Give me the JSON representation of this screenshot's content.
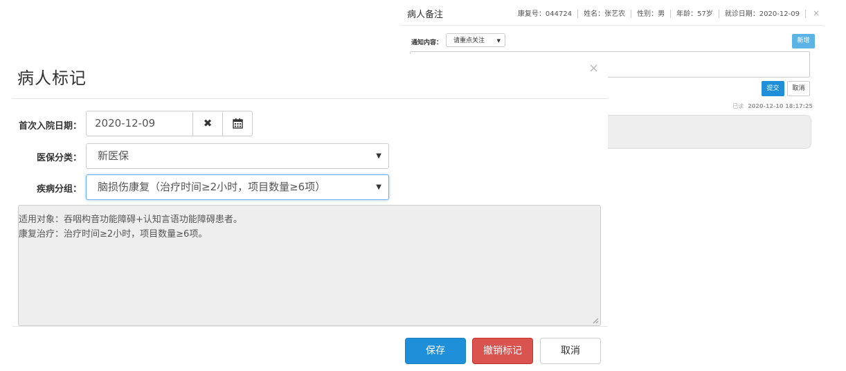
{
  "notes_panel": {
    "title": "病人备注",
    "info": {
      "rehab_no": "康复号：044724",
      "name": "姓名：张艺农",
      "gender": "性别：男",
      "age": "年龄：57岁",
      "visit_date": "就诊日期：2020-12-09",
      "close": "×"
    },
    "notify_label": "通知内容：",
    "notify_select": "请重点关注",
    "add_button": "新增",
    "submit_button": "提交",
    "cancel_button": "取消",
    "read_status": "已读",
    "read_time": "2020-12-10 18:17:25"
  },
  "modal": {
    "title": "病人标记",
    "close": "×",
    "first_admission_label": "首次入院日期：",
    "first_admission_value": "2020-12-09",
    "clear_glyph": "✖",
    "insurance_label": "医保分类：",
    "insurance_value": "新医保",
    "disease_group_label": "疾病分组：",
    "disease_group_value": "脑损伤康复（治疗时间≥2小时，项目数量≥6项）",
    "description_lines": [
      "适用对象：吞咽构音功能障碍+认知言语功能障碍患者。",
      "康复治疗：治疗时间≥2小时，项目数量≥6项。"
    ],
    "save_button": "保存",
    "revoke_button": "撤销标记",
    "cancel_button": "取消"
  },
  "colors": {
    "primary": "#1e8fd8",
    "danger": "#d9534f",
    "light_blue": "#5bb4e5",
    "panel_gray": "#eeeeee"
  }
}
